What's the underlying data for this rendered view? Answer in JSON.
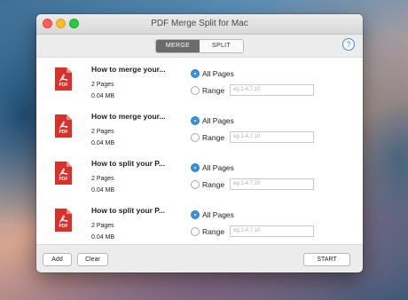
{
  "window": {
    "title": "PDF Merge Split for Mac"
  },
  "toolbar": {
    "tabs": [
      {
        "label": "MERGE",
        "active": true
      },
      {
        "label": "SPLIT",
        "active": false
      }
    ],
    "help_glyph": "?"
  },
  "files": [
    {
      "name": "How to merge your...",
      "pages": "2 Pages",
      "size": "0.04 MB",
      "icon_text": "PDF",
      "all_pages_label": "All Pages",
      "range_label": "Range",
      "range_placeholder": "eg.1-4,7,10",
      "selected": "all"
    },
    {
      "name": "How to merge your...",
      "pages": "2 Pages",
      "size": "0.04 MB",
      "icon_text": "PDF",
      "all_pages_label": "All Pages",
      "range_label": "Range",
      "range_placeholder": "eg.1-4,7,10",
      "selected": "all"
    },
    {
      "name": "How to split your P...",
      "pages": "2 Pages",
      "size": "0.04 MB",
      "icon_text": "PDF",
      "all_pages_label": "All Pages",
      "range_label": "Range",
      "range_placeholder": "eg.1-4,7,10",
      "selected": "all"
    },
    {
      "name": "How to split your P...",
      "pages": "2 Pages",
      "size": "0.04 MB",
      "icon_text": "PDF",
      "all_pages_label": "All Pages",
      "range_label": "Range",
      "range_placeholder": "eg.1-4,7,10",
      "selected": "all"
    }
  ],
  "footer": {
    "add_label": "Add",
    "clear_label": "Clear",
    "start_label": "START"
  },
  "colors": {
    "accent": "#3b8fe3",
    "pdf_red": "#d8302a"
  },
  "icons": [
    "close-icon",
    "minimize-icon",
    "zoom-icon",
    "help-icon",
    "pdf-file-icon"
  ]
}
